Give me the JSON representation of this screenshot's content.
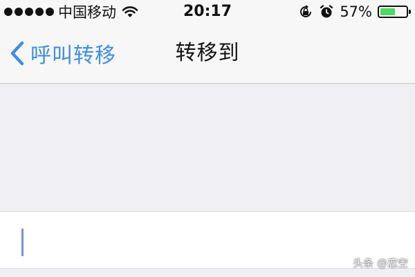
{
  "status_bar": {
    "carrier": "中国移动",
    "time": "20:17",
    "battery_percent": "57%",
    "battery_level": 0.57,
    "battery_color": "#4cd964",
    "icons": [
      "signal-dots-icon",
      "wifi-icon",
      "orientation-lock-icon",
      "alarm-icon",
      "battery-icon"
    ]
  },
  "nav": {
    "back_label": "呼叫转移",
    "title": "转移到",
    "accent_color": "#3d8ee6"
  },
  "form": {
    "phone_value": "",
    "phone_placeholder": ""
  },
  "watermark": "头条 @恋空"
}
